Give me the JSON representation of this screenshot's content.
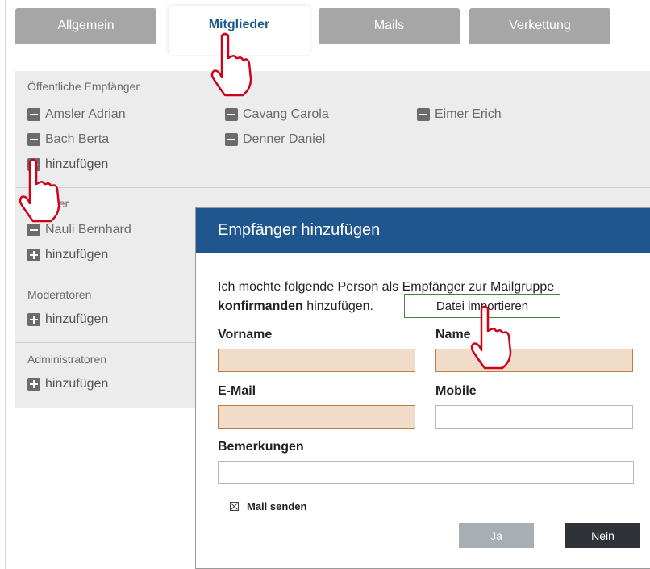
{
  "tabs": [
    {
      "label": "Allgemein",
      "active": false
    },
    {
      "label": "Mitglieder",
      "active": true
    },
    {
      "label": "Mails",
      "active": false
    },
    {
      "label": "Verkettung",
      "active": false
    }
  ],
  "members": {
    "public_title": "Öffentliche Empfänger",
    "public_recipients": [
      "Amsler Adrian",
      "Cavang Carola",
      "Eimer Erich",
      "Bach Berta",
      "Denner Daniel"
    ],
    "second_title_visible": "der",
    "second_recipients": [
      "Nauli Bernhard"
    ],
    "moderators_title": "Moderatoren",
    "admins_title": "Administratoren",
    "add_label": "hinzufügen"
  },
  "dialog": {
    "title": "Empfänger hinzufügen",
    "intro_line1": "Ich möchte folgende Person als Empfänger zur Mailgruppe",
    "intro_group": "konfirmanden",
    "intro_line2_rest": " hinzufügen.",
    "import_label": "Datei importieren",
    "fields": {
      "firstname_label": "Vorname",
      "name_label": "Name",
      "email_label": "E-Mail",
      "mobile_label": "Mobile",
      "notes_label": "Bemerkungen"
    },
    "send_mail_label": "Mail senden",
    "send_mail_checked": true,
    "yes_label": "Ja",
    "no_label": "Nein"
  },
  "colors": {
    "dialog_header": "#1f568e",
    "required_field_bg": "#f1dcc9",
    "required_field_border": "#c07a43",
    "tab_inactive": "#a6a6a6",
    "cursor_red": "#d0021b"
  },
  "icons": {
    "remove": "minus-square-icon",
    "add": "plus-square-icon",
    "pointer": "hand-pointer-icon"
  }
}
